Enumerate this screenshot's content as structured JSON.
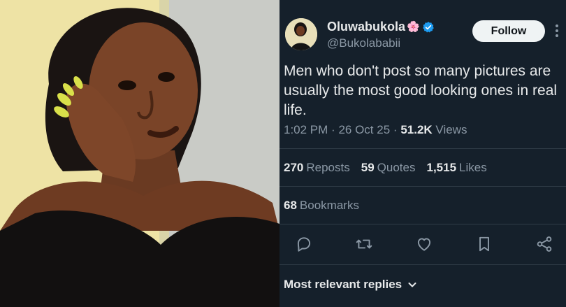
{
  "photo": {
    "subject": "woman-portrait"
  },
  "tweet": {
    "display_name": "Oluwabukola",
    "flower_emoji": "🌸",
    "handle": "@Bukolababii",
    "follow_label": "Follow",
    "text": "Men who don't post so many pictures are usually the most good looking ones in real life.",
    "time": "1:02 PM",
    "date": "26 Oct 25",
    "views_count": "51.2K",
    "views_label": "Views",
    "reposts_count": "270",
    "reposts_label": "Reposts",
    "quotes_count": "59",
    "quotes_label": "Quotes",
    "likes_count": "1,515",
    "likes_label": "Likes",
    "bookmarks_count": "68",
    "bookmarks_label": "Bookmarks",
    "replies_sort": "Most relevant replies"
  },
  "icons": [
    "reply-icon",
    "repost-icon",
    "like-icon",
    "bookmark-icon",
    "share-icon",
    "verified-icon",
    "more-icon",
    "chevron-down-icon"
  ],
  "colors": {
    "background": "#15202b",
    "text": "#e7e9ea",
    "muted": "#8b98a5",
    "verified": "#1d9bf0",
    "follow_bg": "#eff3f4"
  }
}
